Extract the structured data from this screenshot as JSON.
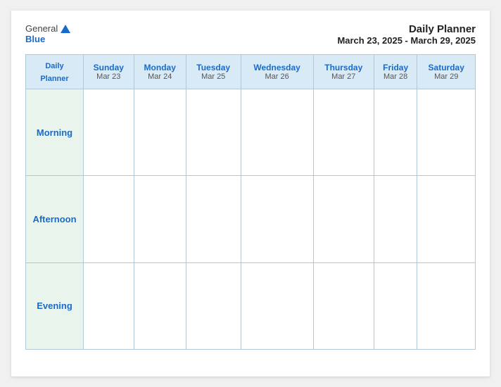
{
  "logo": {
    "general": "General",
    "blue": "Blue"
  },
  "title": {
    "line1": "Daily Planner",
    "line2": "March 23, 2025 - March 29, 2025"
  },
  "header_col": {
    "line1": "Daily",
    "line2": "Planner"
  },
  "days": [
    {
      "name": "Sunday",
      "date": "Mar 23"
    },
    {
      "name": "Monday",
      "date": "Mar 24"
    },
    {
      "name": "Tuesday",
      "date": "Mar 25"
    },
    {
      "name": "Wednesday",
      "date": "Mar 26"
    },
    {
      "name": "Thursday",
      "date": "Mar 27"
    },
    {
      "name": "Friday",
      "date": "Mar 28"
    },
    {
      "name": "Saturday",
      "date": "Mar 29"
    }
  ],
  "periods": [
    "Morning",
    "Afternoon",
    "Evening"
  ]
}
